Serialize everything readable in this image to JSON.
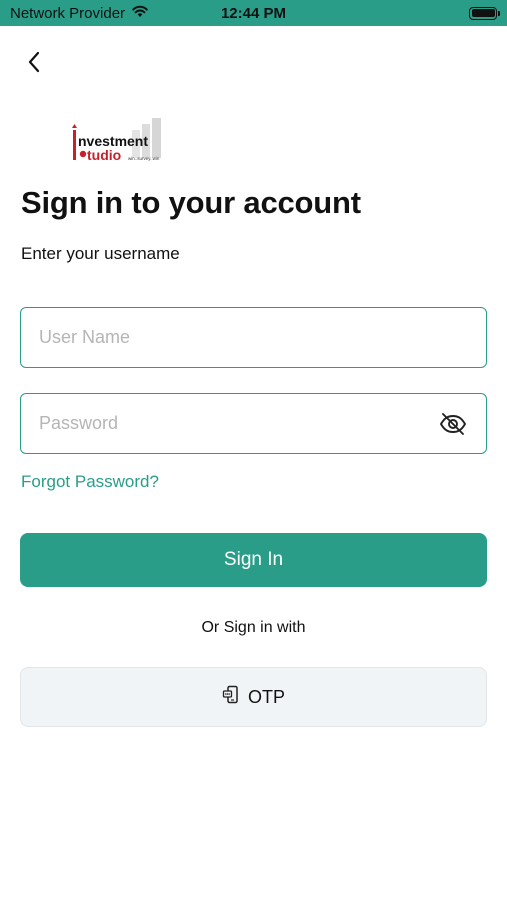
{
  "status_bar": {
    "carrier": "Network Provider",
    "time": "12:44 PM",
    "battery_level": 1.0,
    "background_color": "#2a9d89"
  },
  "logo": {
    "line1": "Investment",
    "line2": "Studio",
    "tagline": "win..survey..win"
  },
  "heading": {
    "title": "Sign in to your account",
    "subtitle": "Enter your username"
  },
  "form": {
    "username_placeholder": "User Name",
    "username_value": "",
    "password_placeholder": "Password",
    "password_value": "",
    "password_toggle_icon": "eye-slash-icon",
    "forgot_password": "Forgot Password?"
  },
  "actions": {
    "sign_in_label": "Sign In",
    "or_text": "Or Sign in with",
    "otp_label": "OTP",
    "otp_icon": "phone-otp-icon"
  },
  "colors": {
    "accent": "#2a9d89",
    "secondary_button_bg": "#f1f4f6",
    "placeholder": "#b5b5b5"
  }
}
